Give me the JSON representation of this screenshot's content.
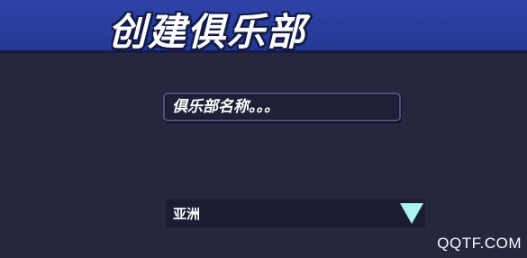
{
  "header": {
    "title": "创建俱乐部"
  },
  "club_form": {
    "name_placeholder": "俱乐部名称。。。",
    "region_selected": "亚洲"
  },
  "watermark": {
    "text": "QQTF.COM"
  },
  "icons": {
    "dropdown": "triangle-down-icon"
  },
  "colors": {
    "header_bg": "#2a40a3",
    "page_bg": "#26263f",
    "dropdown_arrow": "#a9f3f3"
  }
}
